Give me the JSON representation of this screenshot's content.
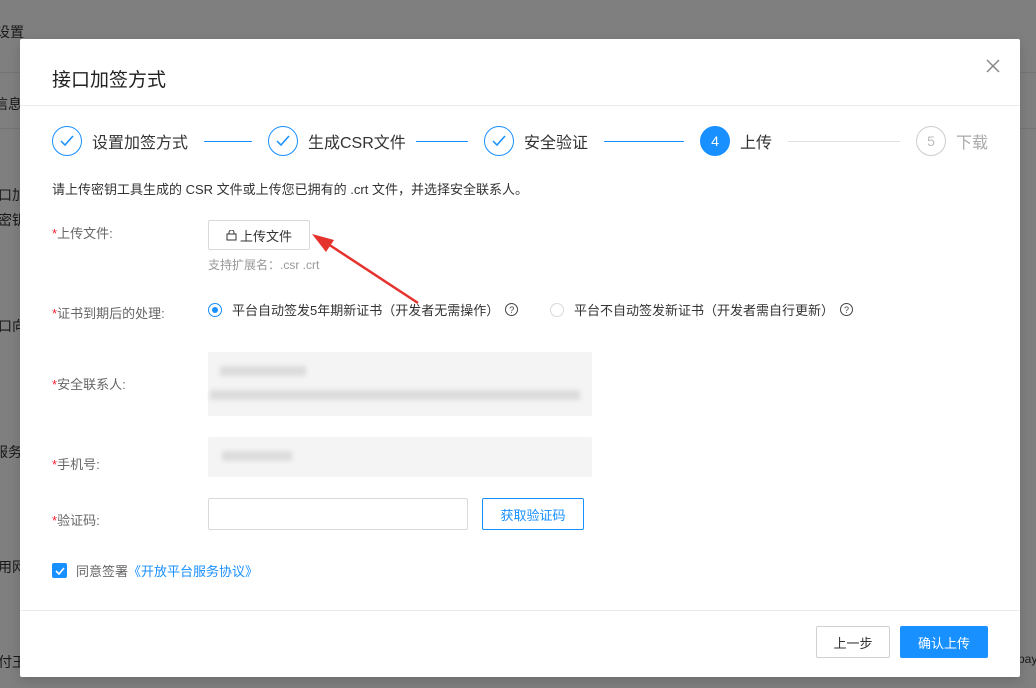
{
  "background": {
    "fragments": [
      "设置",
      "信息",
      "口加",
      "密钥",
      "口向",
      "服务器",
      "用网",
      "付王",
      "pay"
    ]
  },
  "dialog": {
    "title": "接口加签方式",
    "close_icon": "close-icon"
  },
  "steps": [
    {
      "label": "设置加签方式",
      "status": "done",
      "icon": "check-icon"
    },
    {
      "label": "生成CSR文件",
      "status": "done",
      "icon": "check-icon"
    },
    {
      "label": "安全验证",
      "status": "done",
      "icon": "check-icon"
    },
    {
      "number": "4",
      "label": "上传",
      "status": "active"
    },
    {
      "number": "5",
      "label": "下载",
      "status": "pending"
    }
  ],
  "description": "请上传密钥工具生成的 CSR 文件或上传您已拥有的 .crt 文件，并选择安全联系人。",
  "form": {
    "required_mark": "*",
    "upload": {
      "label": "上传文件:",
      "button": "上传文件",
      "button_icon": "lock-icon",
      "hint": "支持扩展名：.csr .crt"
    },
    "expiry": {
      "label": "证书到期后的处理:",
      "options": [
        {
          "label": "平台自动签发5年期新证书（开发者无需操作）",
          "selected": true
        },
        {
          "label": "平台不自动签发新证书（开发者需自行更新）",
          "selected": false
        }
      ],
      "help_icon": "question-circle-icon"
    },
    "contact": {
      "label": "安全联系人:"
    },
    "phone": {
      "label": "手机号:"
    },
    "code": {
      "label": "验证码:",
      "value": "",
      "button": "获取验证码"
    }
  },
  "agreement": {
    "checked": true,
    "prefix": "同意签署",
    "link": "《开放平台服务协议》"
  },
  "footer": {
    "prev": "上一步",
    "confirm": "确认上传"
  },
  "colors": {
    "primary": "#1890ff",
    "required": "#f5222d",
    "annotation_arrow": "#e5322d"
  }
}
